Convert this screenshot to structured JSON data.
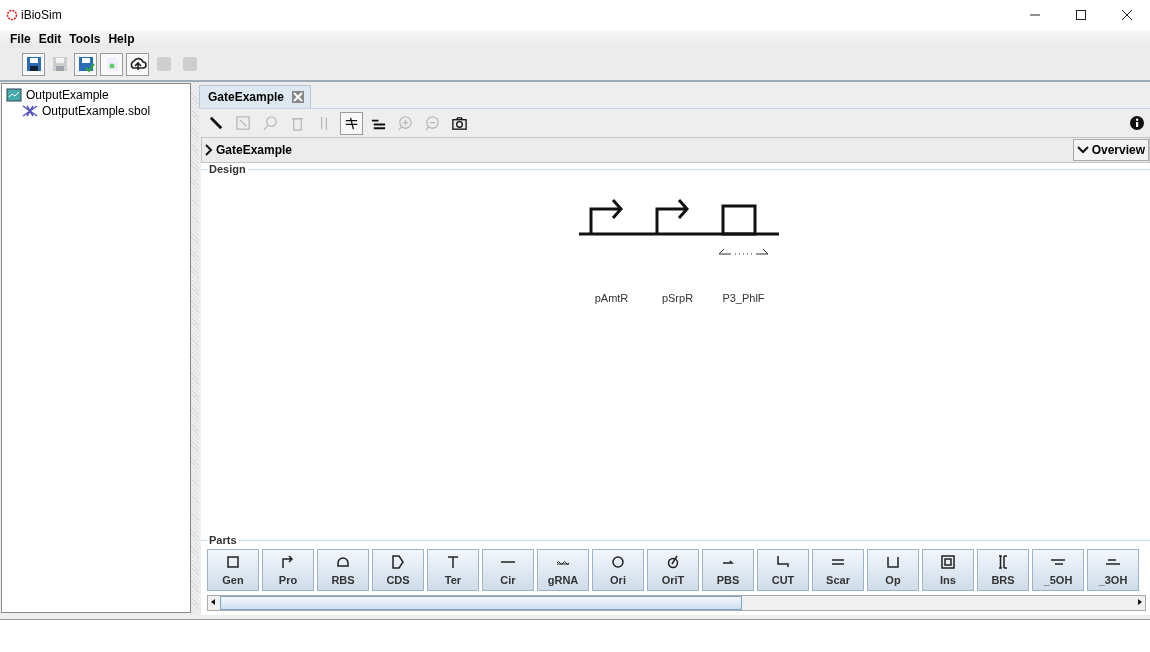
{
  "window": {
    "title": "iBioSim"
  },
  "menu": [
    "File",
    "Edit",
    "Tools",
    "Help"
  ],
  "toolbar": [
    {
      "kind": "save",
      "disabled": false
    },
    {
      "kind": "save",
      "disabled": true
    },
    {
      "kind": "saveas",
      "disabled": false
    },
    {
      "kind": "check",
      "disabled": false
    },
    {
      "kind": "upload",
      "disabled": false
    },
    {
      "kind": "run",
      "disabled": true
    },
    {
      "kind": "stop",
      "disabled": true
    }
  ],
  "tree": {
    "label": "OutputExample",
    "children": [
      {
        "label": "OutputExample.sbol"
      }
    ]
  },
  "tabs": [
    {
      "label": "GateExample",
      "selected": true
    }
  ],
  "editor_tools": [
    {
      "kind": "pencil",
      "disabled": false,
      "selected": false
    },
    {
      "kind": "select",
      "disabled": true,
      "selected": false
    },
    {
      "kind": "find",
      "disabled": true,
      "selected": false
    },
    {
      "kind": "delete",
      "disabled": true,
      "selected": false
    },
    {
      "kind": "flip",
      "disabled": true,
      "selected": false
    },
    {
      "kind": "snap",
      "disabled": false,
      "selected": true
    },
    {
      "kind": "lines",
      "disabled": false,
      "selected": false
    },
    {
      "kind": "zoomin",
      "disabled": true,
      "selected": false
    },
    {
      "kind": "zoomout",
      "disabled": true,
      "selected": false
    },
    {
      "kind": "camera",
      "disabled": false,
      "selected": false
    }
  ],
  "breadcrumb": "GateExample",
  "overview": "Overview",
  "design": {
    "title": "Design",
    "parts": [
      {
        "kind": "promoter",
        "label": "pAmtR"
      },
      {
        "kind": "promoter",
        "label": "pSrpR"
      },
      {
        "kind": "gen",
        "label": "P3_PhlF"
      }
    ]
  },
  "parts": {
    "title": "Parts",
    "buttons": [
      {
        "kind": "gen",
        "label": "Gen"
      },
      {
        "kind": "promoter",
        "label": "Pro"
      },
      {
        "kind": "rbs",
        "label": "RBS"
      },
      {
        "kind": "cds",
        "label": "CDS"
      },
      {
        "kind": "ter",
        "label": "Ter"
      },
      {
        "kind": "cir",
        "label": "Cir"
      },
      {
        "kind": "grna",
        "label": "gRNA"
      },
      {
        "kind": "ori",
        "label": "Ori"
      },
      {
        "kind": "orit",
        "label": "OriT"
      },
      {
        "kind": "pbs",
        "label": "PBS"
      },
      {
        "kind": "cut",
        "label": "CUT"
      },
      {
        "kind": "scar",
        "label": "Scar"
      },
      {
        "kind": "op",
        "label": "Op"
      },
      {
        "kind": "ins",
        "label": "Ins"
      },
      {
        "kind": "brs",
        "label": "BRS"
      },
      {
        "kind": "oh5",
        "label": "_5OH"
      },
      {
        "kind": "oh3",
        "label": "_3OH"
      }
    ]
  }
}
